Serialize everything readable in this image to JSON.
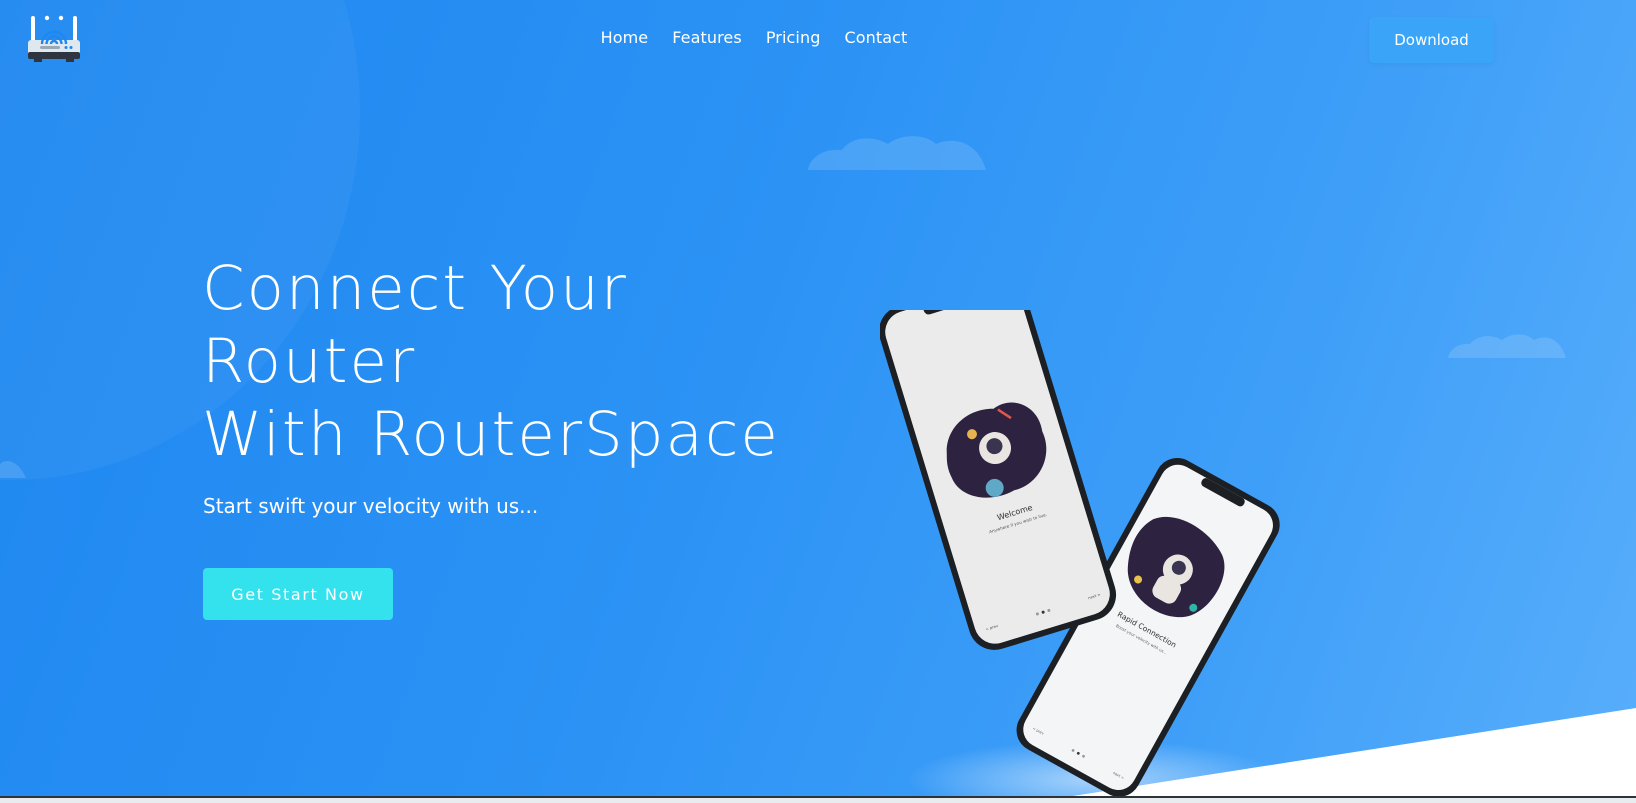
{
  "nav": {
    "items": [
      {
        "label": "Home"
      },
      {
        "label": "Features"
      },
      {
        "label": "Pricing"
      },
      {
        "label": "Contact"
      }
    ],
    "download_label": "Download"
  },
  "hero": {
    "title_line1": "Connect Your",
    "title_line2": "Router",
    "title_line3": "With RouterSpace",
    "subtitle": "Start swift your velocity with us...",
    "cta_label": "Get Start Now"
  },
  "phone_front": {
    "screen_title": "Welcome",
    "screen_subtitle": "Anywhere if you wish to live.",
    "prev_label": "< prev",
    "next_label": "next >"
  },
  "phone_back": {
    "screen_title": "Rapid Connection",
    "screen_subtitle": "Boost your velocity with us...",
    "prev_label": "< prev",
    "next_label": "next >"
  },
  "icons": {
    "logo": "router-logo-icon",
    "cloud": "cloud-icon"
  },
  "colors": {
    "accent": "#1e87f0",
    "cta": "#34e2ee",
    "download": "#3aa5f8"
  }
}
